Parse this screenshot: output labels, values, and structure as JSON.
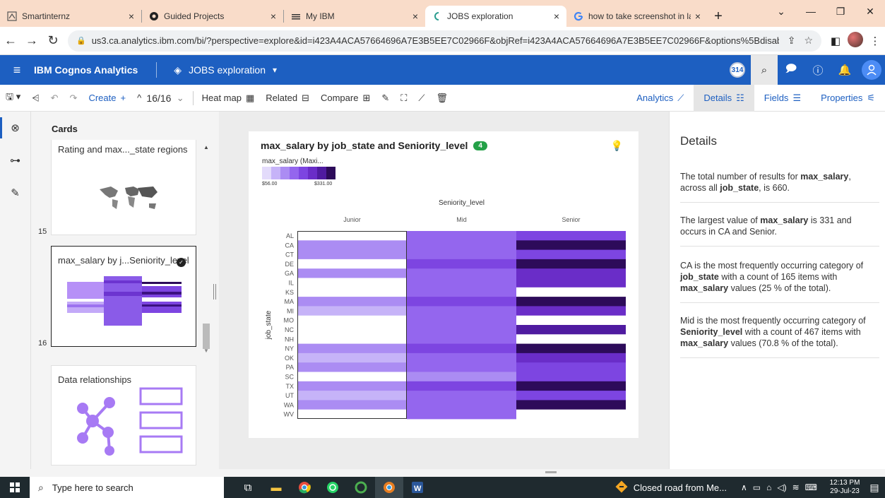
{
  "browser": {
    "tabs": [
      {
        "label": "Smartinternz",
        "icon": "smartinternz-favicon"
      },
      {
        "label": "Guided Projects",
        "icon": "github-favicon"
      },
      {
        "label": "My IBM",
        "icon": "ibm-favicon"
      },
      {
        "label": "JOBS exploration",
        "icon": "cognos-favicon",
        "active": true
      },
      {
        "label": "how to take screenshot in lap",
        "icon": "google-favicon"
      }
    ],
    "new_tab": "+",
    "url": "us3.ca.analytics.ibm.com/bi/?perspective=explore&id=i423A4ACA57664696A7E3B5EE7C02966F&objRef=i423A4ACA57664696A7E3B5EE7C02966F&options%5Bdisable..."
  },
  "header": {
    "brand": "IBM Cognos Analytics",
    "asset_title": "JOBS exploration",
    "notification_count": "314"
  },
  "toolbar": {
    "create": "Create",
    "page_indicator": "16/16",
    "heatmap": "Heat map",
    "related": "Related",
    "compare": "Compare",
    "analytics": "Analytics",
    "details": "Details",
    "fields": "Fields",
    "properties": "Properties"
  },
  "cards_panel": {
    "title": "Cards",
    "cards": [
      {
        "label": "Rating and max..._state regions",
        "number": "15"
      },
      {
        "label": "max_salary by j...Seniority_level",
        "number": "16"
      },
      {
        "label": "Data relationships",
        "number": ""
      }
    ]
  },
  "viz": {
    "title": "max_salary by job_state and Seniority_level",
    "badge": "4",
    "legend_title": "max_salary (Maxi...",
    "legend_min": "$56.00",
    "legend_max": "$331.00",
    "colors": {
      "scale": [
        "#e3dbfb",
        "#c6b3f8",
        "#ab8cf3",
        "#9466ee",
        "#7d45e1",
        "#6a2dc8",
        "#4f1ba0",
        "#2d0b5a"
      ],
      "empty": "#ffffff"
    }
  },
  "chart_data": {
    "type": "heatmap",
    "title": "max_salary by job_state and Seniority_level",
    "xlabel": "Seniority_level",
    "ylabel": "job_state",
    "x": [
      "Junior",
      "Mid",
      "Senior"
    ],
    "y": [
      "AL",
      "CA",
      "CT",
      "DE",
      "GA",
      "IL",
      "KS",
      "MA",
      "MI",
      "MO",
      "NC",
      "NH",
      "NY",
      "OK",
      "PA",
      "SC",
      "TX",
      "UT",
      "WA",
      "WV"
    ],
    "value_range": [
      56,
      331
    ],
    "legend": "top-left",
    "values": [
      [
        null,
        180,
        200
      ],
      [
        150,
        170,
        331
      ],
      [
        140,
        190,
        220
      ],
      [
        null,
        200,
        300
      ],
      [
        130,
        180,
        260
      ],
      [
        null,
        190,
        250
      ],
      [
        null,
        170,
        null
      ],
      [
        140,
        200,
        300
      ],
      [
        110,
        190,
        230
      ],
      [
        null,
        180,
        null
      ],
      [
        null,
        190,
        290
      ],
      [
        null,
        170,
        null
      ],
      [
        140,
        200,
        310
      ],
      [
        110,
        190,
        260
      ],
      [
        150,
        180,
        220
      ],
      [
        null,
        130,
        200
      ],
      [
        140,
        200,
        300
      ],
      [
        120,
        160,
        200
      ],
      [
        150,
        190,
        320
      ],
      [
        null,
        160,
        null
      ]
    ]
  },
  "details": {
    "title": "Details",
    "items": [
      [
        {
          "t": "The total number of results for "
        },
        {
          "t": "max_salary",
          "b": true
        },
        {
          "t": ", across all "
        },
        {
          "t": "job_state",
          "b": true
        },
        {
          "t": ", is 660."
        }
      ],
      [
        {
          "t": "The largest value of "
        },
        {
          "t": "max_salary",
          "b": true
        },
        {
          "t": " is 331 and occurs in CA and Senior."
        }
      ],
      [
        {
          "t": "CA is the most frequently occurring category of "
        },
        {
          "t": "job_state",
          "b": true
        },
        {
          "t": " with a count of 165 items with "
        },
        {
          "t": "max_salary",
          "b": true
        },
        {
          "t": " values (25 % of the total)."
        }
      ],
      [
        {
          "t": "Mid is the most frequently occurring category of "
        },
        {
          "t": "Seniority_level",
          "b": true
        },
        {
          "t": " with a count of 467 items with "
        },
        {
          "t": "max_salary",
          "b": true
        },
        {
          "t": " values (70.8 % of the total)."
        }
      ]
    ]
  },
  "taskbar": {
    "search_placeholder": "Type here to search",
    "news": "Closed road from Me...",
    "time": "12:13 PM",
    "date": "29-Jul-23"
  }
}
